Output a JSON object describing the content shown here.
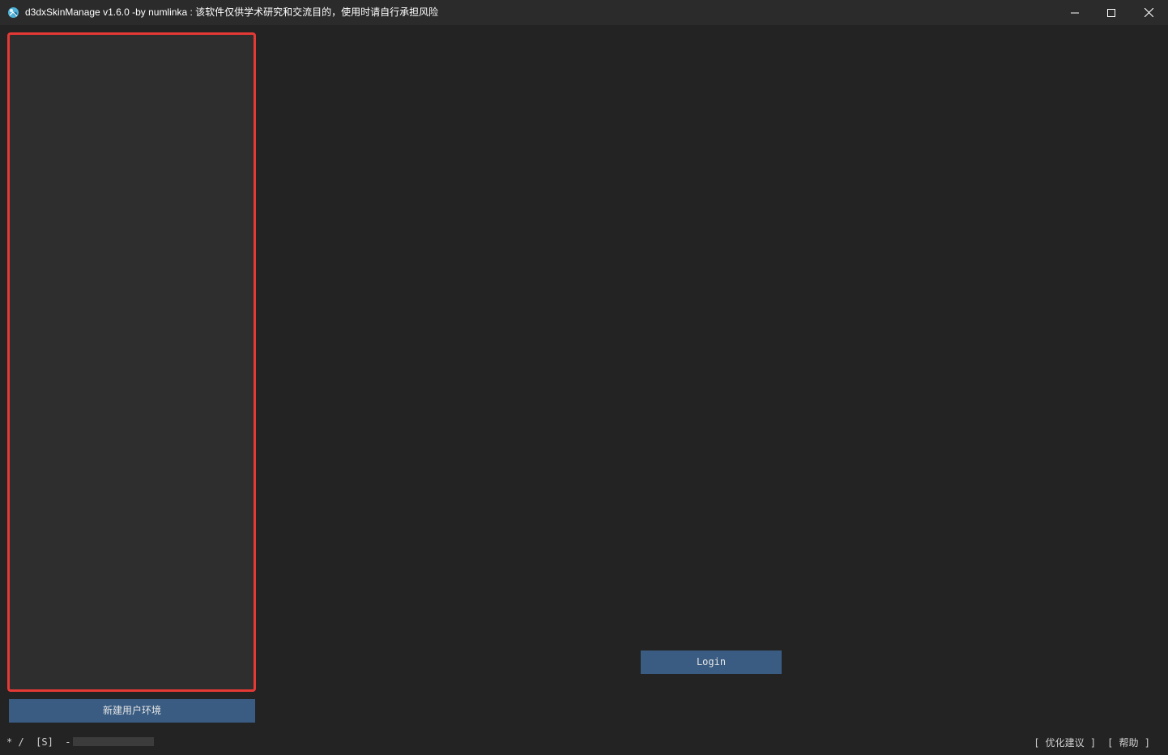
{
  "window": {
    "title": "d3dxSkinManage v1.6.0 -by numlinka : 该软件仅供学术研究和交流目的，使用时请自行承担风险",
    "icon": "app-logo-icon",
    "controls": [
      "minimize-icon",
      "maximize-icon",
      "close-icon"
    ]
  },
  "sidebar": {
    "items": [],
    "new_env_label": "新建用户环境",
    "highlight_color": "#e53935"
  },
  "main": {
    "login_label": "Login"
  },
  "statusbar": {
    "indicator_star": "*",
    "indicator_slash": "/",
    "indicator_mode": "[S]",
    "indicator_dash": "-",
    "links": [
      {
        "label": "[ 优化建议 ]"
      },
      {
        "label": "[ 帮助 ]"
      }
    ]
  },
  "colors": {
    "background": "#232323",
    "panel": "#2e2e2e",
    "button": "#3a5c82",
    "titlebar": "#2b2b2b"
  }
}
